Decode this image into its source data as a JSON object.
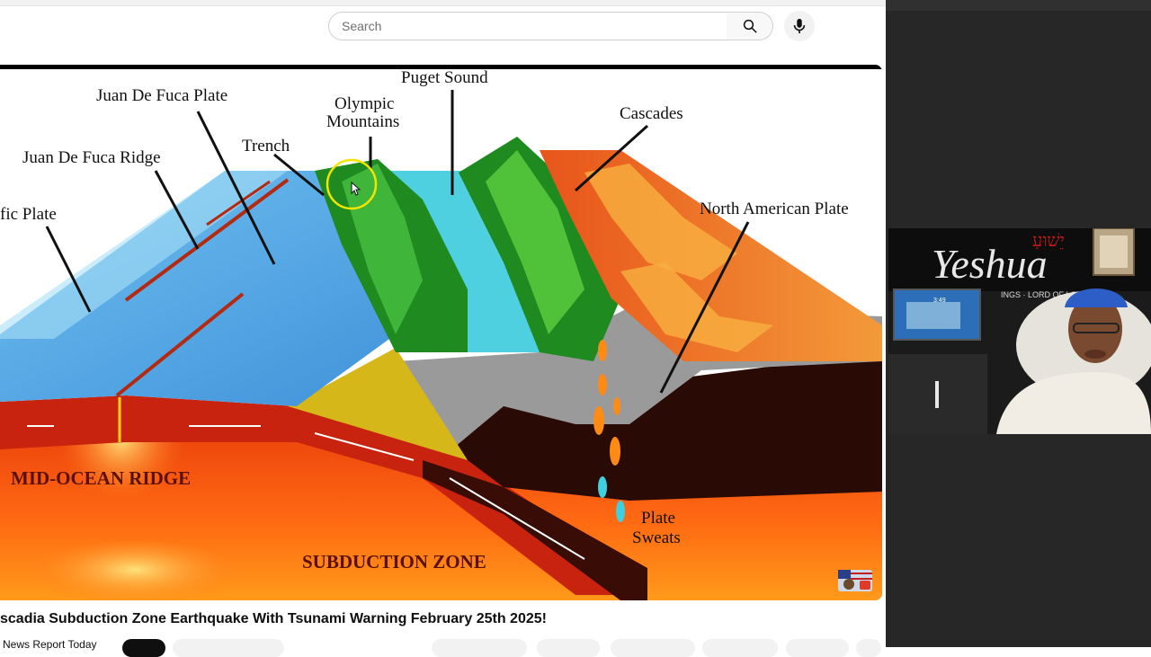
{
  "search": {
    "placeholder": "Search"
  },
  "icons": {
    "search": "search-icon",
    "mic": "microphone-icon",
    "channel_logo": "flag-eagle-logo-icon"
  },
  "diagram": {
    "labels": {
      "puget_sound": "Puget Sound",
      "juan_de_fuca_plate": "Juan De Fuca Plate",
      "olympic_1": "Olympic",
      "olympic_2": "Mountains",
      "trench": "Trench",
      "cascades": "Cascades",
      "juan_de_fuca_ridge": "Juan De Fuca Ridge",
      "pacific_plate": "fic Plate",
      "north_american_plate": "North American Plate",
      "mid_ocean_ridge": "MID-OCEAN RIDGE",
      "plate_sweats_1": "Plate",
      "plate_sweats_2": "Sweats",
      "subduction_zone": "SUBDUCTION ZONE"
    }
  },
  "webcam": {
    "banner": "Yeshua",
    "hebrew": "יֵשׁוּעַ",
    "subbanner": "INGS · LORD OF LORD",
    "monitor_time": "3:49"
  },
  "video": {
    "title": "scadia Subduction Zone Earthquake With Tsunami Warning February 25th 2025!",
    "channel": "News Report Today"
  },
  "colors": {
    "accent_search_border": "#cfcfcf",
    "ocean": "#4fa9e3",
    "magma": "#ff5a14",
    "crust": "#f07a1a",
    "forest": "#1f8a1f",
    "cursor_ring": "#f2e600"
  }
}
